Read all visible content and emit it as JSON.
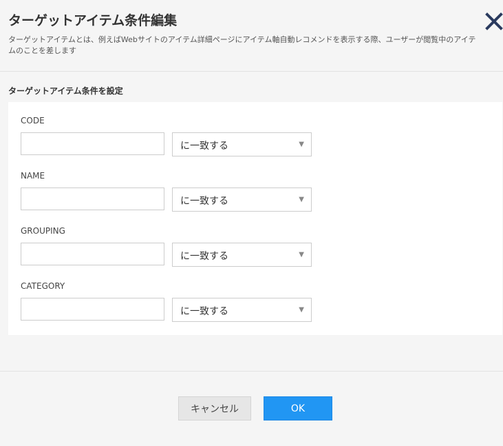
{
  "dialog": {
    "title": "ターゲットアイテム条件編集",
    "description": "ターゲットアイテムとは、例えばWebサイトのアイテム詳細ページにアイテム軸自動レコメンドを表示する際、ユーザーが閲覧中のアイテムのことを差します",
    "close_icon": "close-icon",
    "section_title": "ターゲットアイテム条件を設定"
  },
  "fields": [
    {
      "label": "CODE",
      "value": "",
      "match": "に一致する"
    },
    {
      "label": "NAME",
      "value": "",
      "match": "に一致する"
    },
    {
      "label": "GROUPING",
      "value": "",
      "match": "に一致する"
    },
    {
      "label": "CATEGORY",
      "value": "",
      "match": "に一致する"
    }
  ],
  "footer": {
    "cancel_label": "キャンセル",
    "ok_label": "OK"
  },
  "colors": {
    "background": "#f5f5f5",
    "panel": "#ffffff",
    "accent": "#2196f3",
    "close_icon": "#2a3a5e"
  }
}
